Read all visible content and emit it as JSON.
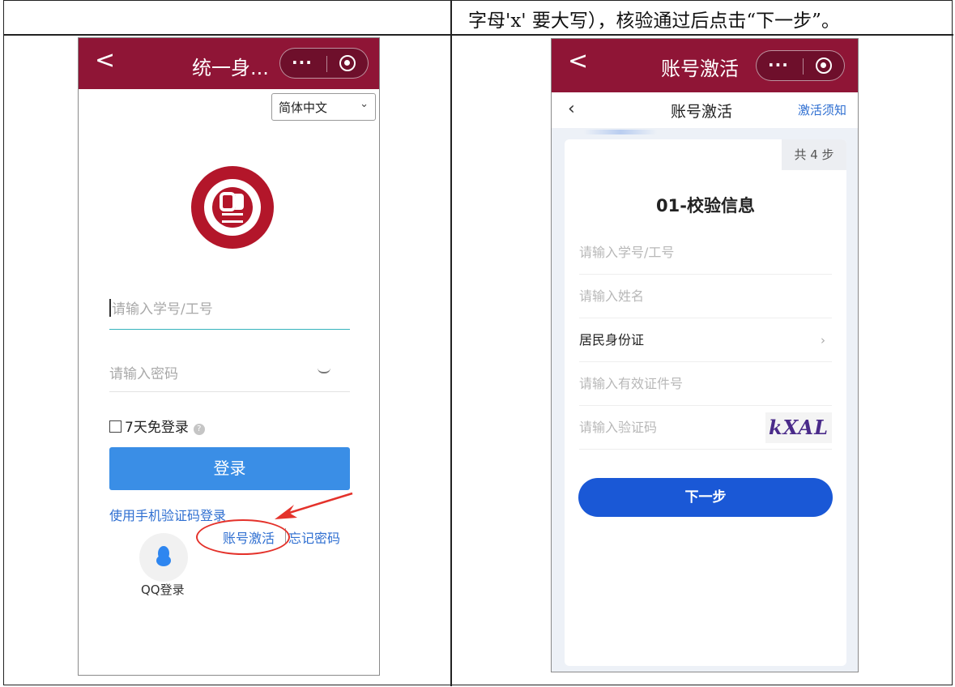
{
  "instruction": "字母'x' 要大写），核验通过后点击“下一步”。",
  "left_phone": {
    "title": "统一身...",
    "back": "<",
    "capsule_dots": "···",
    "language": "简体中文",
    "username_placeholder": "请输入学号/工号",
    "password_placeholder": "请输入密码",
    "remember_label": "7天免登录",
    "help_icon": "?",
    "login_button": "登录",
    "sms_login": "使用手机验证码登录",
    "activate_link": "账号激活",
    "forgot_link": "忘记密码",
    "qq_login": "QQ登录"
  },
  "right_phone": {
    "title": "账号激活",
    "back": "<",
    "capsule_dots": "···",
    "nav_back": "‹",
    "nav_title": "账号激活",
    "nav_notice": "激活须知",
    "steps": "共 4 步",
    "step_title": "01-校验信息",
    "fields": [
      "请输入学号/工号",
      "请输入姓名",
      "居民身份证",
      "请输入有效证件号",
      "请输入验证码"
    ],
    "chevron": "›",
    "captcha": "kXAL",
    "next_button": "下一步"
  },
  "colors": {
    "wechat_bar": "#8f1536",
    "primary_blue": "#3a8ee6",
    "link_blue": "#2f6fd1",
    "next_blue": "#1a58d6",
    "annotation_red": "#e4322b"
  }
}
